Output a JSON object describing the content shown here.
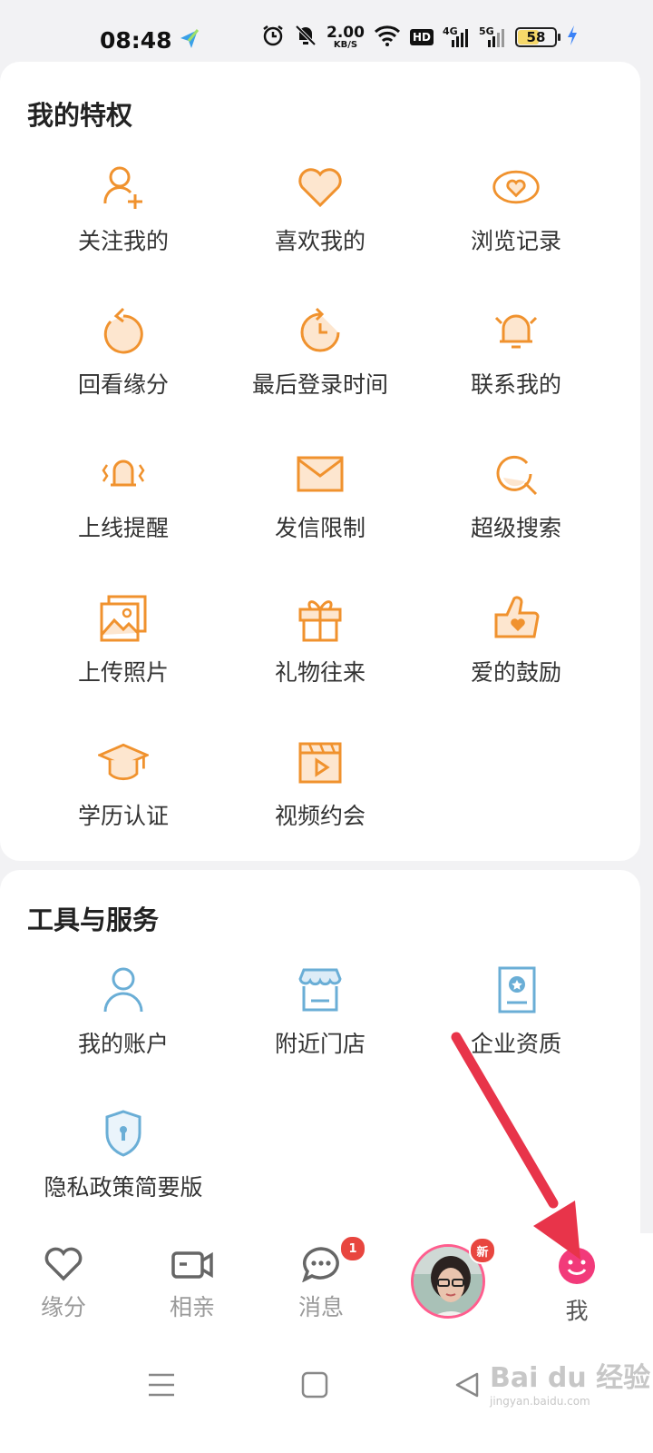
{
  "status_bar": {
    "time": "08:48",
    "net_speed": "2.00",
    "net_unit": "KB/S",
    "hd": "HD",
    "net1": "4G",
    "net2": "5G",
    "battery": "58",
    "battery_level": 0.58
  },
  "privileges": {
    "title": "我的特权",
    "items": [
      {
        "label": "关注我的",
        "icon": "add-user-icon"
      },
      {
        "label": "喜欢我的",
        "icon": "heart-icon"
      },
      {
        "label": "浏览记录",
        "icon": "eye-heart-icon"
      },
      {
        "label": "回看缘分",
        "icon": "rewind-icon"
      },
      {
        "label": "最后登录时间",
        "icon": "clock-return-icon"
      },
      {
        "label": "联系我的",
        "icon": "bell-ringing-icon"
      },
      {
        "label": "上线提醒",
        "icon": "bell-vibrate-icon"
      },
      {
        "label": "发信限制",
        "icon": "envelope-icon"
      },
      {
        "label": "超级搜索",
        "icon": "search-icon"
      },
      {
        "label": "上传照片",
        "icon": "photo-icon"
      },
      {
        "label": "礼物往来",
        "icon": "gift-icon"
      },
      {
        "label": "爱的鼓励",
        "icon": "thumbs-up-heart-icon"
      },
      {
        "label": "学历认证",
        "icon": "graduation-cap-icon"
      },
      {
        "label": "视频约会",
        "icon": "video-play-icon"
      }
    ]
  },
  "tools": {
    "title": "工具与服务",
    "items": [
      {
        "label": "我的账户",
        "icon": "user-icon"
      },
      {
        "label": "附近门店",
        "icon": "store-icon"
      },
      {
        "label": "企业资质",
        "icon": "certificate-icon"
      },
      {
        "label": "隐私政策简要版",
        "icon": "shield-lock-icon"
      }
    ]
  },
  "bottom_nav": {
    "items": [
      {
        "label": "缘分",
        "icon": "heart-outline-icon"
      },
      {
        "label": "相亲",
        "icon": "video-camera-icon"
      },
      {
        "label": "消息",
        "icon": "chat-bubble-icon",
        "badge": "1"
      },
      {
        "label": "",
        "icon": "avatar",
        "badge": "新"
      },
      {
        "label": "我",
        "icon": "smile-icon"
      }
    ]
  },
  "colors": {
    "accent_orange": "#f0922e",
    "accent_blue": "#6aaed6",
    "badge_red": "#e8463f",
    "me_pink": "#f23a7a",
    "arrow_red": "#e8344a"
  },
  "watermark": {
    "logo": "Bai du 经验",
    "url": "jingyan.baidu.com"
  }
}
